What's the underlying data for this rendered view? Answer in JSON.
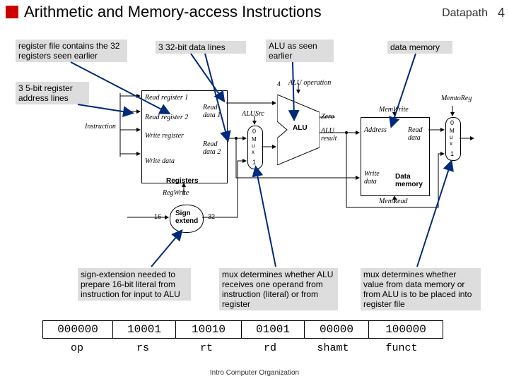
{
  "header": {
    "title": "Arithmetic and Memory-access Instructions",
    "section": "Datapath",
    "slide_num": "4"
  },
  "notes": {
    "regfile": "register file contains the 32 registers seen earlier",
    "addr3x5": "3 5-bit register address lines",
    "data3x32": "3 32-bit data lines",
    "alu": "ALU as seen earlier",
    "dmem": "data memory",
    "signext": "sign-extension needed to prepare 16-bit literal from instruction for input to ALU",
    "mux1": "mux determines whether ALU receives one operand from instruction (literal) or from register",
    "mux2": "mux determines whether value from data memory or from ALU is to be placed into register file"
  },
  "diagram": {
    "instr": "Instruction",
    "rf": {
      "read_reg1": "Read register 1",
      "read_reg2": "Read register 2",
      "write_reg": "Write register",
      "write_data": "Write data",
      "read_data1": "Read data 1",
      "read_data2": "Read data 2",
      "title": "Registers",
      "regwrite": "RegWrite"
    },
    "alu": {
      "op": "ALU operation",
      "op_width": "4",
      "zero": "Zero",
      "name": "ALU",
      "result": "ALU result",
      "src": "ALUSrc",
      "mux0": "0",
      "muxM": "M\nu\nx",
      "mux1": "1"
    },
    "signext": {
      "in": "16",
      "name": "Sign\nextend",
      "out": "32"
    },
    "dmem": {
      "addr": "Address",
      "wdata": "Write\ndata",
      "rdata": "Read\ndata",
      "name": "Data\nmemory",
      "memwrite": "MemWrite",
      "memread": "MemRead",
      "memtoreg": "MemtoReg",
      "mux0": "0",
      "muxM": "M\nu\nx",
      "mux1": "1"
    }
  },
  "instr_bits": {
    "fields": [
      "000000",
      "10001",
      "10010",
      "01001",
      "00000",
      "100000"
    ],
    "labels": [
      "op",
      "rs",
      "rt",
      "rd",
      "shamt",
      "funct"
    ]
  },
  "footer": "Intro Computer Organization"
}
